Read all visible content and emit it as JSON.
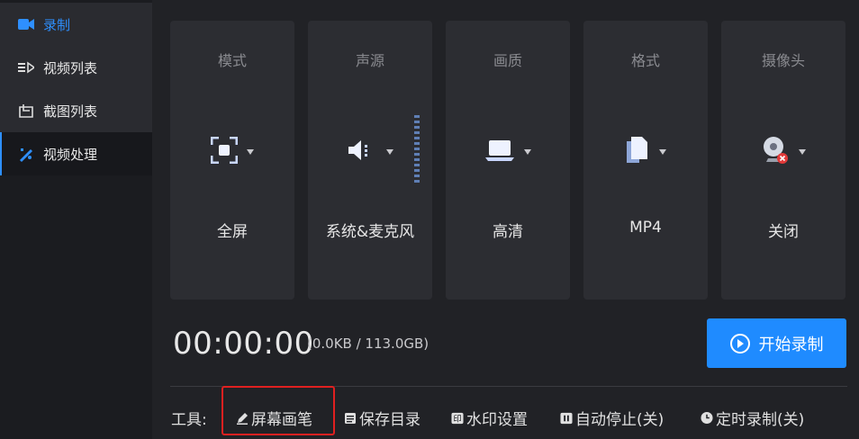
{
  "sidebar": {
    "items": [
      {
        "label": "录制",
        "icon": "video-camera-icon"
      },
      {
        "label": "视频列表",
        "icon": "video-list-icon"
      },
      {
        "label": "截图列表",
        "icon": "screenshot-list-icon"
      },
      {
        "label": "视频处理",
        "icon": "video-edit-icon"
      }
    ]
  },
  "cards": [
    {
      "title": "模式",
      "value": "全屏",
      "icon": "fullscreen-icon"
    },
    {
      "title": "声源",
      "value": "系统&麦克风",
      "icon": "speaker-icon"
    },
    {
      "title": "画质",
      "value": "高清",
      "icon": "laptop-icon"
    },
    {
      "title": "格式",
      "value": "MP4",
      "icon": "file-icon"
    },
    {
      "title": "摄像头",
      "value": "关闭",
      "icon": "webcam-off-icon"
    }
  ],
  "timer": "00:00:00",
  "size_info": "(0.0KB / 113.0GB)",
  "start_button": "开始录制",
  "tools": {
    "label": "工具:",
    "items": [
      {
        "label": "屏幕画笔",
        "icon": "pen-icon"
      },
      {
        "label": "保存目录",
        "icon": "folder-list-icon"
      },
      {
        "label": "水印设置",
        "icon": "watermark-icon"
      },
      {
        "label": "自动停止(关)",
        "icon": "pause-icon"
      },
      {
        "label": "定时录制(关)",
        "icon": "clock-icon"
      }
    ]
  },
  "colors": {
    "accent": "#1f8bff",
    "highlight": "#e02020",
    "card_bg": "#2c2d32"
  }
}
